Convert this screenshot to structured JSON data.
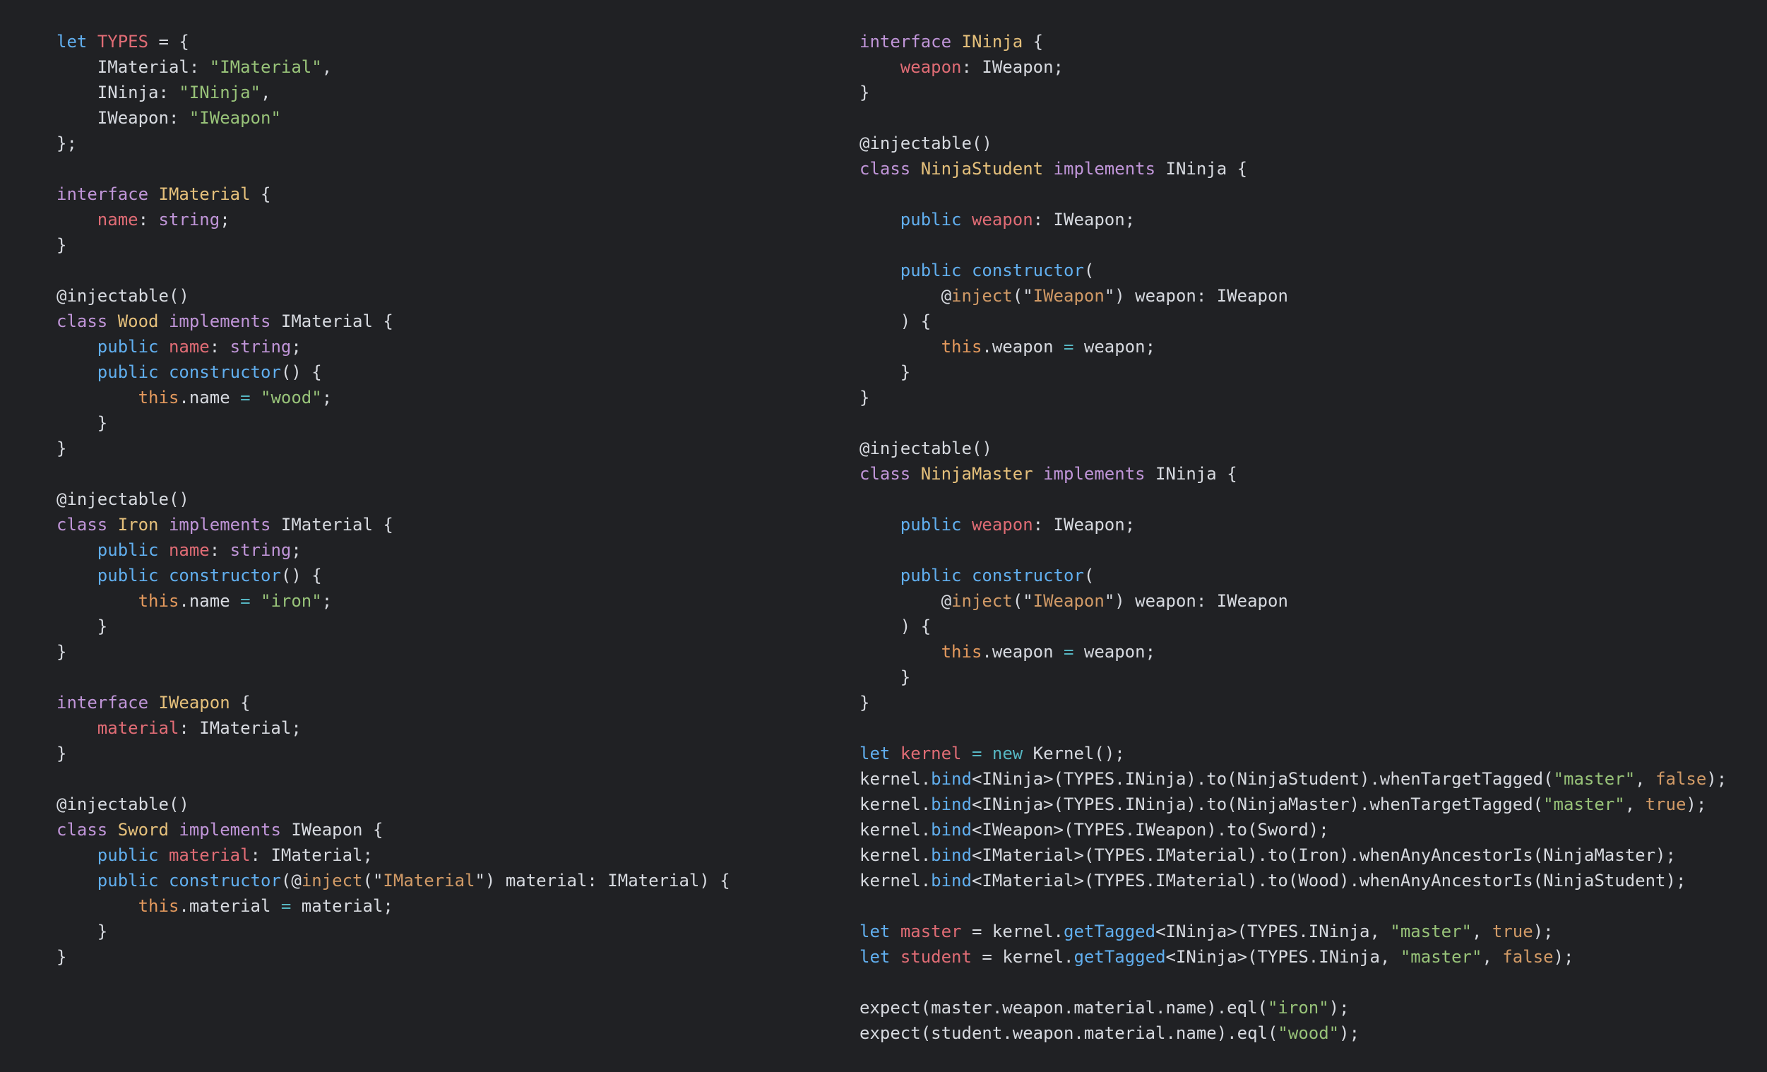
{
  "colors": {
    "background": "#202124",
    "plain": "#d7dae0",
    "keyword": "#c095d8",
    "keyword_blue": "#61afef",
    "type_name": "#e5c07b",
    "property": "#e06c75",
    "string": "#98c379",
    "literal": "#d19a66"
  },
  "editor": {
    "left_column": [
      [
        [
          "kwblue",
          "let"
        ],
        [
          "plain",
          " "
        ],
        [
          "var",
          "TYPES"
        ],
        [
          "plain",
          " = {"
        ]
      ],
      [
        [
          "plain",
          "    IMaterial: "
        ],
        [
          "str",
          "\"IMaterial\""
        ],
        [
          "plain",
          ","
        ]
      ],
      [
        [
          "plain",
          "    INinja: "
        ],
        [
          "str",
          "\"INinja\""
        ],
        [
          "plain",
          ","
        ]
      ],
      [
        [
          "plain",
          "    IWeapon: "
        ],
        [
          "str",
          "\"IWeapon\""
        ]
      ],
      [
        [
          "plain",
          "};"
        ]
      ],
      [],
      [
        [
          "kw",
          "interface"
        ],
        [
          "plain",
          " "
        ],
        [
          "type",
          "IMaterial"
        ],
        [
          "plain",
          " {"
        ]
      ],
      [
        [
          "plain",
          "    "
        ],
        [
          "var",
          "name"
        ],
        [
          "plain",
          ": "
        ],
        [
          "kw",
          "string"
        ],
        [
          "plain",
          ";"
        ]
      ],
      [
        [
          "plain",
          "}"
        ]
      ],
      [],
      [
        [
          "plain",
          "@injectable()"
        ]
      ],
      [
        [
          "kw",
          "class"
        ],
        [
          "plain",
          " "
        ],
        [
          "type",
          "Wood"
        ],
        [
          "plain",
          " "
        ],
        [
          "kw",
          "implements"
        ],
        [
          "plain",
          " IMaterial {"
        ]
      ],
      [
        [
          "plain",
          "    "
        ],
        [
          "kwblue",
          "public"
        ],
        [
          "plain",
          " "
        ],
        [
          "var",
          "name"
        ],
        [
          "plain",
          ": "
        ],
        [
          "kw",
          "string"
        ],
        [
          "plain",
          ";"
        ]
      ],
      [
        [
          "plain",
          "    "
        ],
        [
          "kwblue",
          "public"
        ],
        [
          "plain",
          " "
        ],
        [
          "fn",
          "constructor"
        ],
        [
          "plain",
          "() {"
        ]
      ],
      [
        [
          "plain",
          "        "
        ],
        [
          "this",
          "this"
        ],
        [
          "plain",
          ".name "
        ],
        [
          "op",
          "="
        ],
        [
          "plain",
          " "
        ],
        [
          "str",
          "\"wood\""
        ],
        [
          "plain",
          ";"
        ]
      ],
      [
        [
          "plain",
          "    }"
        ]
      ],
      [
        [
          "plain",
          "}"
        ]
      ],
      [],
      [
        [
          "plain",
          "@injectable()"
        ]
      ],
      [
        [
          "kw",
          "class"
        ],
        [
          "plain",
          " "
        ],
        [
          "type",
          "Iron"
        ],
        [
          "plain",
          " "
        ],
        [
          "kw",
          "implements"
        ],
        [
          "plain",
          " IMaterial {"
        ]
      ],
      [
        [
          "plain",
          "    "
        ],
        [
          "kwblue",
          "public"
        ],
        [
          "plain",
          " "
        ],
        [
          "var",
          "name"
        ],
        [
          "plain",
          ": "
        ],
        [
          "kw",
          "string"
        ],
        [
          "plain",
          ";"
        ]
      ],
      [
        [
          "plain",
          "    "
        ],
        [
          "kwblue",
          "public"
        ],
        [
          "plain",
          " "
        ],
        [
          "fn",
          "constructor"
        ],
        [
          "plain",
          "() {"
        ]
      ],
      [
        [
          "plain",
          "        "
        ],
        [
          "this",
          "this"
        ],
        [
          "plain",
          ".name "
        ],
        [
          "op",
          "="
        ],
        [
          "plain",
          " "
        ],
        [
          "str",
          "\"iron\""
        ],
        [
          "plain",
          ";"
        ]
      ],
      [
        [
          "plain",
          "    }"
        ]
      ],
      [
        [
          "plain",
          "}"
        ]
      ],
      [],
      [
        [
          "kw",
          "interface"
        ],
        [
          "plain",
          " "
        ],
        [
          "type",
          "IWeapon"
        ],
        [
          "plain",
          " {"
        ]
      ],
      [
        [
          "plain",
          "    "
        ],
        [
          "var",
          "material"
        ],
        [
          "plain",
          ": IMaterial;"
        ]
      ],
      [
        [
          "plain",
          "}"
        ]
      ],
      [],
      [
        [
          "plain",
          "@injectable()"
        ]
      ],
      [
        [
          "kw",
          "class"
        ],
        [
          "plain",
          " "
        ],
        [
          "type",
          "Sword"
        ],
        [
          "plain",
          " "
        ],
        [
          "kw",
          "implements"
        ],
        [
          "plain",
          " IWeapon {"
        ]
      ],
      [
        [
          "plain",
          "    "
        ],
        [
          "kwblue",
          "public"
        ],
        [
          "plain",
          " "
        ],
        [
          "var",
          "material"
        ],
        [
          "plain",
          ": IMaterial;"
        ]
      ],
      [
        [
          "plain",
          "    "
        ],
        [
          "kwblue",
          "public"
        ],
        [
          "plain",
          " "
        ],
        [
          "fn",
          "constructor"
        ],
        [
          "plain",
          "(@"
        ],
        [
          "orange",
          "inject"
        ],
        [
          "plain",
          "(\""
        ],
        [
          "orange",
          "IMaterial"
        ],
        [
          "plain",
          "\") material: IMaterial) {"
        ]
      ],
      [
        [
          "plain",
          "        "
        ],
        [
          "this",
          "this"
        ],
        [
          "plain",
          ".material "
        ],
        [
          "op",
          "="
        ],
        [
          "plain",
          " material;"
        ]
      ],
      [
        [
          "plain",
          "    }"
        ]
      ],
      [
        [
          "plain",
          "}"
        ]
      ]
    ],
    "right_column": [
      [
        [
          "kw",
          "interface"
        ],
        [
          "plain",
          " "
        ],
        [
          "type",
          "INinja"
        ],
        [
          "plain",
          " {"
        ]
      ],
      [
        [
          "plain",
          "    "
        ],
        [
          "var",
          "weapon"
        ],
        [
          "plain",
          ": IWeapon;"
        ]
      ],
      [
        [
          "plain",
          "}"
        ]
      ],
      [],
      [
        [
          "plain",
          "@injectable()"
        ]
      ],
      [
        [
          "kw",
          "class"
        ],
        [
          "plain",
          " "
        ],
        [
          "type",
          "NinjaStudent"
        ],
        [
          "plain",
          " "
        ],
        [
          "kw",
          "implements"
        ],
        [
          "plain",
          " INinja {"
        ]
      ],
      [],
      [
        [
          "plain",
          "    "
        ],
        [
          "kwblue",
          "public"
        ],
        [
          "plain",
          " "
        ],
        [
          "var",
          "weapon"
        ],
        [
          "plain",
          ": IWeapon;"
        ]
      ],
      [],
      [
        [
          "plain",
          "    "
        ],
        [
          "kwblue",
          "public"
        ],
        [
          "plain",
          " "
        ],
        [
          "fn",
          "constructor"
        ],
        [
          "plain",
          "("
        ]
      ],
      [
        [
          "plain",
          "        @"
        ],
        [
          "orange",
          "inject"
        ],
        [
          "plain",
          "(\""
        ],
        [
          "orange",
          "IWeapon"
        ],
        [
          "plain",
          "\") weapon: IWeapon"
        ]
      ],
      [
        [
          "plain",
          "    ) {"
        ]
      ],
      [
        [
          "plain",
          "        "
        ],
        [
          "this",
          "this"
        ],
        [
          "plain",
          ".weapon "
        ],
        [
          "op",
          "="
        ],
        [
          "plain",
          " weapon;"
        ]
      ],
      [
        [
          "plain",
          "    }"
        ]
      ],
      [
        [
          "plain",
          "}"
        ]
      ],
      [],
      [
        [
          "plain",
          "@injectable()"
        ]
      ],
      [
        [
          "kw",
          "class"
        ],
        [
          "plain",
          " "
        ],
        [
          "type",
          "NinjaMaster"
        ],
        [
          "plain",
          " "
        ],
        [
          "kw",
          "implements"
        ],
        [
          "plain",
          " INinja {"
        ]
      ],
      [],
      [
        [
          "plain",
          "    "
        ],
        [
          "kwblue",
          "public"
        ],
        [
          "plain",
          " "
        ],
        [
          "var",
          "weapon"
        ],
        [
          "plain",
          ": IWeapon;"
        ]
      ],
      [],
      [
        [
          "plain",
          "    "
        ],
        [
          "kwblue",
          "public"
        ],
        [
          "plain",
          " "
        ],
        [
          "fn",
          "constructor"
        ],
        [
          "plain",
          "("
        ]
      ],
      [
        [
          "plain",
          "        @"
        ],
        [
          "orange",
          "inject"
        ],
        [
          "plain",
          "(\""
        ],
        [
          "orange",
          "IWeapon"
        ],
        [
          "plain",
          "\") weapon: IWeapon"
        ]
      ],
      [
        [
          "plain",
          "    ) {"
        ]
      ],
      [
        [
          "plain",
          "        "
        ],
        [
          "this",
          "this"
        ],
        [
          "plain",
          ".weapon "
        ],
        [
          "op",
          "="
        ],
        [
          "plain",
          " weapon;"
        ]
      ],
      [
        [
          "plain",
          "    }"
        ]
      ],
      [
        [
          "plain",
          "}"
        ]
      ],
      [],
      [
        [
          "kwblue",
          "let"
        ],
        [
          "plain",
          " "
        ],
        [
          "var",
          "kernel"
        ],
        [
          "plain",
          " "
        ],
        [
          "op",
          "="
        ],
        [
          "plain",
          " "
        ],
        [
          "kwteal",
          "new"
        ],
        [
          "plain",
          " Kernel();"
        ]
      ],
      [
        [
          "plain",
          "kernel."
        ],
        [
          "fn",
          "bind"
        ],
        [
          "plain",
          "<INinja>(TYPES.INinja).to(NinjaStudent).whenTargetTagged("
        ],
        [
          "str",
          "\"master\""
        ],
        [
          "plain",
          ", "
        ],
        [
          "orange",
          "false"
        ],
        [
          "plain",
          ");"
        ]
      ],
      [
        [
          "plain",
          "kernel."
        ],
        [
          "fn",
          "bind"
        ],
        [
          "plain",
          "<INinja>(TYPES.INinja).to(NinjaMaster).whenTargetTagged("
        ],
        [
          "str",
          "\"master\""
        ],
        [
          "plain",
          ", "
        ],
        [
          "orange",
          "true"
        ],
        [
          "plain",
          ");"
        ]
      ],
      [
        [
          "plain",
          "kernel."
        ],
        [
          "fn",
          "bind"
        ],
        [
          "plain",
          "<IWeapon>(TYPES.IWeapon).to(Sword);"
        ]
      ],
      [
        [
          "plain",
          "kernel."
        ],
        [
          "fn",
          "bind"
        ],
        [
          "plain",
          "<IMaterial>(TYPES.IMaterial).to(Iron).whenAnyAncestorIs(NinjaMaster);"
        ]
      ],
      [
        [
          "plain",
          "kernel."
        ],
        [
          "fn",
          "bind"
        ],
        [
          "plain",
          "<IMaterial>(TYPES.IMaterial).to(Wood).whenAnyAncestorIs(NinjaStudent);"
        ]
      ],
      [],
      [
        [
          "kwblue",
          "let"
        ],
        [
          "plain",
          " "
        ],
        [
          "var",
          "master"
        ],
        [
          "plain",
          " = kernel."
        ],
        [
          "fn",
          "getTagged"
        ],
        [
          "plain",
          "<INinja>(TYPES.INinja, "
        ],
        [
          "str",
          "\"master\""
        ],
        [
          "plain",
          ", "
        ],
        [
          "orange",
          "true"
        ],
        [
          "plain",
          ");"
        ]
      ],
      [
        [
          "kwblue",
          "let"
        ],
        [
          "plain",
          " "
        ],
        [
          "var",
          "student"
        ],
        [
          "plain",
          " = kernel."
        ],
        [
          "fn",
          "getTagged"
        ],
        [
          "plain",
          "<INinja>(TYPES.INinja, "
        ],
        [
          "str",
          "\"master\""
        ],
        [
          "plain",
          ", "
        ],
        [
          "orange",
          "false"
        ],
        [
          "plain",
          ");"
        ]
      ],
      [],
      [
        [
          "plain",
          "expect(master.weapon.material.name).eql("
        ],
        [
          "str",
          "\"iron\""
        ],
        [
          "plain",
          ");"
        ]
      ],
      [
        [
          "plain",
          "expect(student.weapon.material.name).eql("
        ],
        [
          "str",
          "\"wood\""
        ],
        [
          "plain",
          ");"
        ]
      ]
    ]
  }
}
